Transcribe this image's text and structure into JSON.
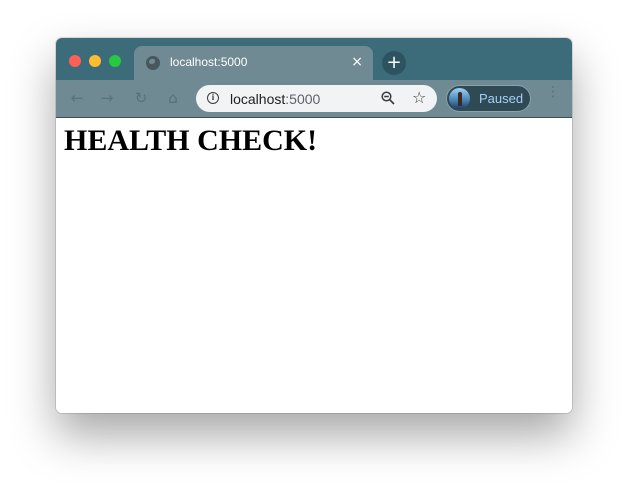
{
  "tab": {
    "title": "localhost:5000",
    "close_glyph": "×",
    "favicon": "globe-icon"
  },
  "new_tab_glyph": "+",
  "toolbar": {
    "back_glyph": "←",
    "forward_glyph": "→",
    "reload_glyph": "↻",
    "home_glyph": "⌂",
    "info_glyph": "i",
    "star_glyph": "☆",
    "menu_glyph": "⋮"
  },
  "omnibox": {
    "host": "localhost",
    "port": ":5000"
  },
  "profile": {
    "label": "Paused"
  },
  "page": {
    "heading": "HEALTH CHECK!"
  },
  "colors": {
    "titlebar": "#3c6c7a",
    "tab_active": "#6f8a92",
    "profile_text": "#a6cdf5"
  }
}
